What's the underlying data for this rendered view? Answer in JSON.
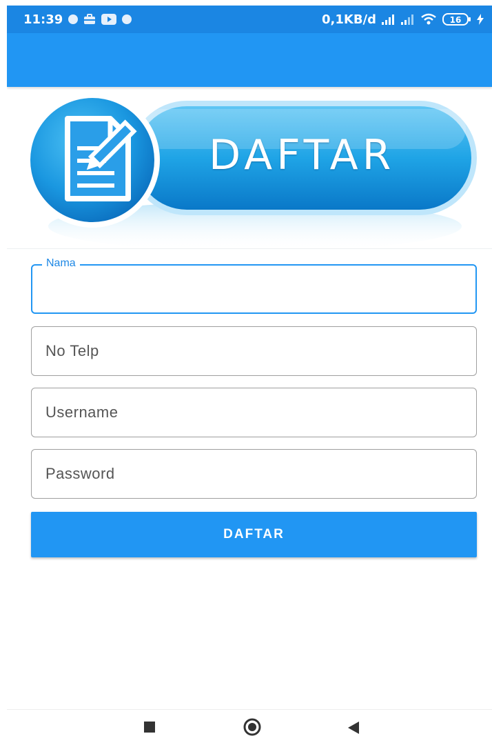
{
  "status_bar": {
    "time": "11:39",
    "network_speed": "0,1KB/d",
    "battery_level": "16",
    "icons": [
      "notification-dot-icon",
      "briefcase-icon",
      "youtube-icon",
      "notification-dot-icon",
      "signal-icon",
      "signal-icon",
      "wifi-icon",
      "battery-icon",
      "charging-icon"
    ]
  },
  "banner": {
    "title": "DAFTAR",
    "icon": "document-edit-icon"
  },
  "form": {
    "nama_label": "Nama",
    "telp_label": "No Telp",
    "username_label": "Username",
    "password_label": "Password",
    "submit_label": "DAFTAR"
  },
  "nav_bar": {
    "icons": [
      "recents-square-icon",
      "home-circle-icon",
      "back-triangle-icon"
    ]
  },
  "colors": {
    "status_bar": "#1b86e3",
    "app_bar": "#2196f3",
    "accent": "#1e88e5",
    "banner_dark": "#0a78c8",
    "banner_light": "#43b8f0"
  }
}
